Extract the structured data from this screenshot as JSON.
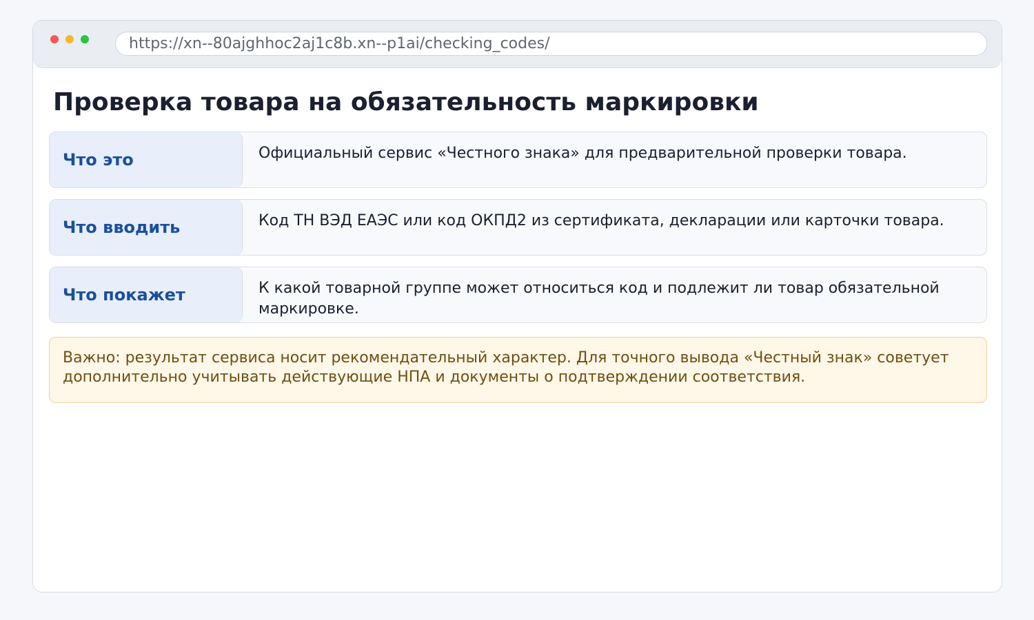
{
  "browser": {
    "url": "https://xn--80ajghhoc2aj1c8b.xn--p1ai/checking_codes/",
    "traffic_lights": [
      "close",
      "minimize",
      "maximize"
    ]
  },
  "page": {
    "title": "Проверка товара на обязательность маркировки",
    "rows": [
      {
        "label": "Что это",
        "value": "Официальный сервис «Честного знака» для предварительной проверки товара."
      },
      {
        "label": "Что вводить",
        "value": "Код ТН ВЭД ЕАЭС или код ОКПД2 из сертификата, декларации или карточки товара."
      },
      {
        "label": "Что покажет",
        "value": "К какой товарной группе может относиться код и подлежит ли товар обязательной маркировке."
      }
    ],
    "notice": "Важно: результат сервиса носит рекомендательный характер. Для точного вывода «Честный знак» советует дополнительно учитывать действующие НПА и документы о подтверждении соответствия."
  },
  "colors": {
    "background": "#f5f7fa",
    "label_text": "#1a4f9c",
    "label_bg": "#e8eefa",
    "notice_bg": "#fff7e8",
    "notice_text": "#6e4f13",
    "close": "#f25a52",
    "minimize": "#f7b72e",
    "maximize": "#2bc341"
  }
}
